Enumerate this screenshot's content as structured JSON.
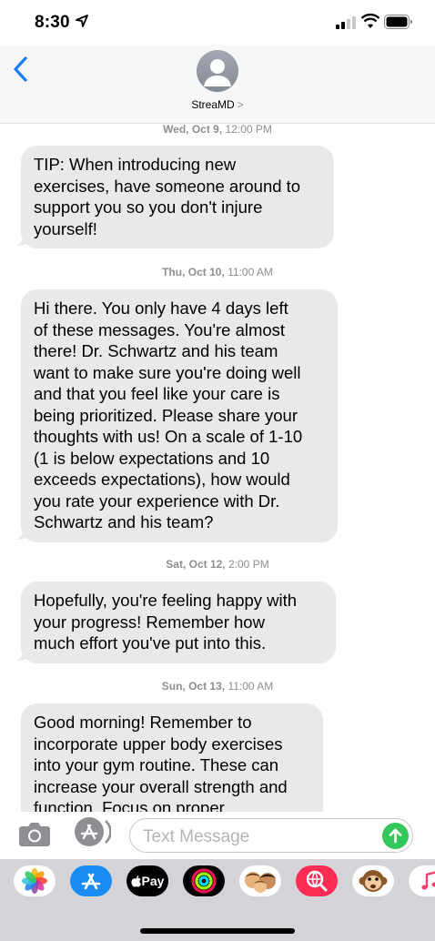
{
  "status_bar": {
    "time": "8:30",
    "icons": [
      "location-arrow-icon",
      "signal-bars-icon",
      "wifi-icon",
      "battery-icon"
    ]
  },
  "header": {
    "contact_name": "StreaMD",
    "chevron": ">",
    "back_icon": "chevron-left-icon",
    "avatar_icon": "person-silhouette-icon"
  },
  "thread": {
    "messages": [
      {
        "timestamp_day": "Wed, Oct 9,",
        "timestamp_time": "12:00 PM",
        "lines": [
          "TIP: When introducing new",
          "exercises, have someone around to",
          "support you so you don't injure",
          "yourself!"
        ]
      },
      {
        "timestamp_day": "Thu, Oct 10,",
        "timestamp_time": "11:00 AM",
        "lines": [
          "Hi there. You only have 4 days left",
          "of these messages. You're almost",
          "there! Dr. Schwartz and his team",
          "want to make sure you're doing well",
          "and that you feel like your care is",
          "being prioritized. Please share your",
          "thoughts with us! On a scale of 1-10",
          "(1 is below expectations and 10",
          "exceeds expectations), how would",
          "you rate your experience with Dr.",
          "Schwartz and his team?"
        ]
      },
      {
        "timestamp_day": "Sat, Oct 12,",
        "timestamp_time": "2:00 PM",
        "lines": [
          "Hopefully, you're feeling happy with",
          "your progress! Remember how",
          "much effort you've put into this."
        ]
      },
      {
        "timestamp_day": "Sun, Oct 13,",
        "timestamp_time": "11:00 AM",
        "lines": [
          "Good morning! Remember to",
          "incorporate upper body exercises",
          "into your gym routine. These can",
          "increase your overall strength and",
          "function. Focus on proper"
        ]
      }
    ]
  },
  "input_bar": {
    "placeholder": "Text Message",
    "camera_icon": "camera-icon",
    "apps_icon": "app-store-icon",
    "send_icon": "send-arrow-icon",
    "send_color": "#34c759"
  },
  "app_drawer": {
    "apps": [
      {
        "name": "photos-app-icon",
        "label": ""
      },
      {
        "name": "app-store-app-icon",
        "label": ""
      },
      {
        "name": "apple-pay-app-icon",
        "label": "Pay"
      },
      {
        "name": "activity-app-icon",
        "label": ""
      },
      {
        "name": "memoji-app-icon",
        "label": ""
      },
      {
        "name": "web-search-app-icon",
        "label": ""
      },
      {
        "name": "monkey-animoji-app-icon",
        "label": ""
      },
      {
        "name": "music-app-icon",
        "label": ""
      }
    ]
  },
  "colors": {
    "accent_blue": "#1a7cf5",
    "bubble_gray": "#e9e9eb",
    "timestamp_gray": "#8e8e93",
    "send_green": "#34c759"
  }
}
